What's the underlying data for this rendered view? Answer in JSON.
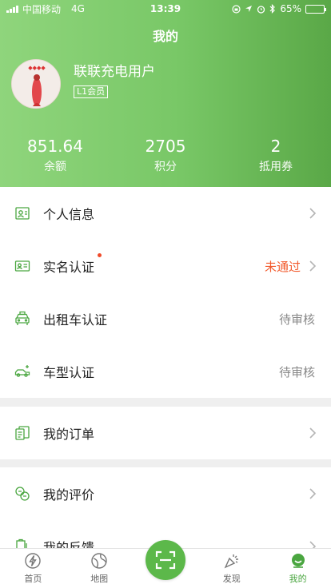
{
  "status_bar": {
    "carrier": "中国移动",
    "network": "4G",
    "time": "13:39",
    "battery": "65%",
    "battery_level": 0.65
  },
  "header": {
    "title": "我的",
    "username": "联联充电用户",
    "level": "L1会员",
    "stats": [
      {
        "value": "851.64",
        "label": "余额"
      },
      {
        "value": "2705",
        "label": "积分"
      },
      {
        "value": "2",
        "label": "抵用券"
      }
    ]
  },
  "menu": {
    "group1": [
      {
        "label": "个人信息",
        "status": "",
        "icon": "profile-icon"
      },
      {
        "label": "实名认证",
        "status": "未通过",
        "icon": "id-card-icon",
        "dot": true
      },
      {
        "label": "出租车认证",
        "status": "待审核",
        "icon": "taxi-icon"
      },
      {
        "label": "车型认证",
        "status": "待审核",
        "icon": "car-icon"
      }
    ],
    "group2": [
      {
        "label": "我的订单",
        "icon": "order-icon"
      }
    ],
    "group3": [
      {
        "label": "我的评价",
        "icon": "review-icon"
      },
      {
        "label": "我的反馈",
        "icon": "feedback-icon"
      }
    ]
  },
  "tabbar": {
    "tabs": [
      {
        "label": "首页",
        "icon": "home-bolt-icon"
      },
      {
        "label": "地图",
        "icon": "map-icon"
      },
      {
        "label": "",
        "icon": "scan-icon"
      },
      {
        "label": "发现",
        "icon": "discover-icon"
      },
      {
        "label": "我的",
        "icon": "me-icon"
      }
    ]
  },
  "colors": {
    "accent": "#5cb84a",
    "warning": "#f25a2c",
    "muted": "#888888"
  }
}
